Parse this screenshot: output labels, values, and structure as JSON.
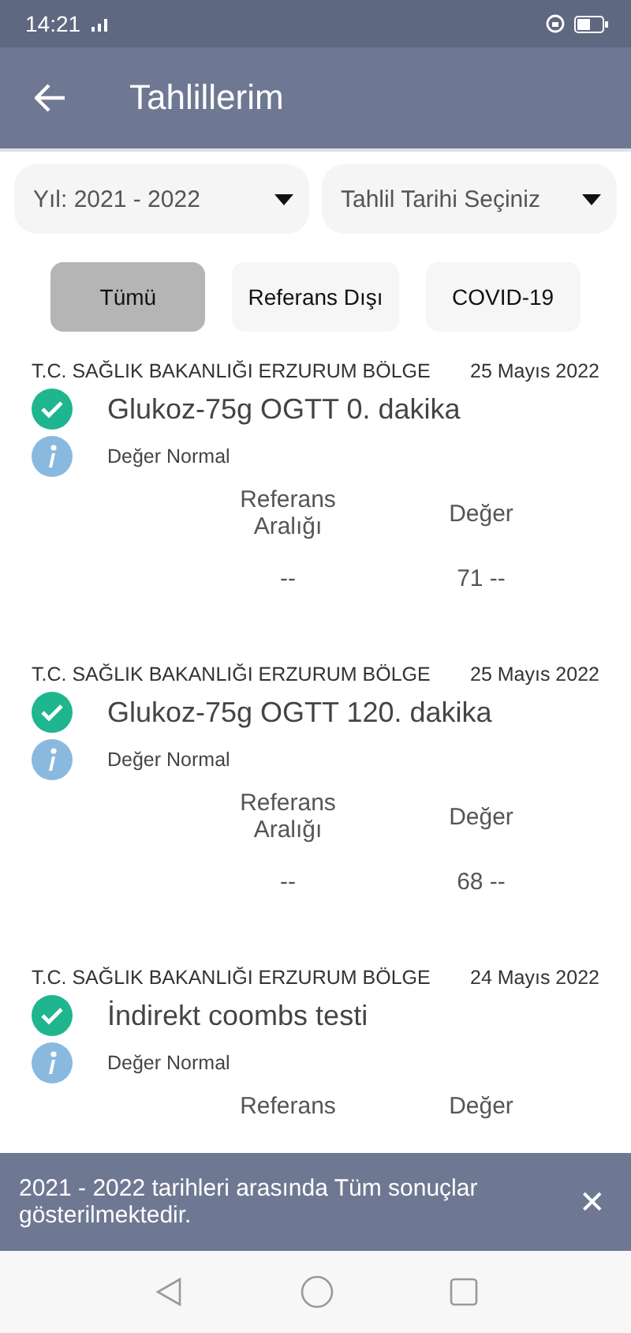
{
  "status_bar": {
    "time": "14:21"
  },
  "app_bar": {
    "title": "Tahlillerim"
  },
  "filters": {
    "year": "Yıl: 2021 - 2022",
    "date": "Tahlil Tarihi Seçiniz"
  },
  "chips": [
    {
      "label": "Tümü",
      "selected": true
    },
    {
      "label": "Referans Dışı",
      "selected": false
    },
    {
      "label": "COVID-19",
      "selected": false
    }
  ],
  "results": [
    {
      "source": "T.C. SAĞLIK BAKANLIĞI ERZURUM BÖLGE",
      "date": "25 Mayıs 2022",
      "title": "Glukoz-75g OGTT 0. dakika",
      "note": "Değer Normal",
      "ref_header": "Referans Aralığı",
      "value_header": "Değer",
      "ref": "--",
      "value": "71 --"
    },
    {
      "source": "T.C. SAĞLIK BAKANLIĞI ERZURUM BÖLGE",
      "date": "25 Mayıs 2022",
      "title": "Glukoz-75g OGTT 120. dakika",
      "note": "Değer Normal",
      "ref_header": "Referans Aralığı",
      "value_header": "Değer",
      "ref": "--",
      "value": "68 --"
    },
    {
      "source": "T.C. SAĞLIK BAKANLIĞI ERZURUM BÖLGE",
      "date": "24 Mayıs 2022",
      "title": "İndirekt coombs testi",
      "note": "Değer Normal",
      "ref_header": "Referans",
      "value_header": "Değer"
    }
  ],
  "snackbar": {
    "text": "2021 - 2022 tarihleri arasında Tüm sonuçlar gösterilmektedir.",
    "close": "✕"
  }
}
